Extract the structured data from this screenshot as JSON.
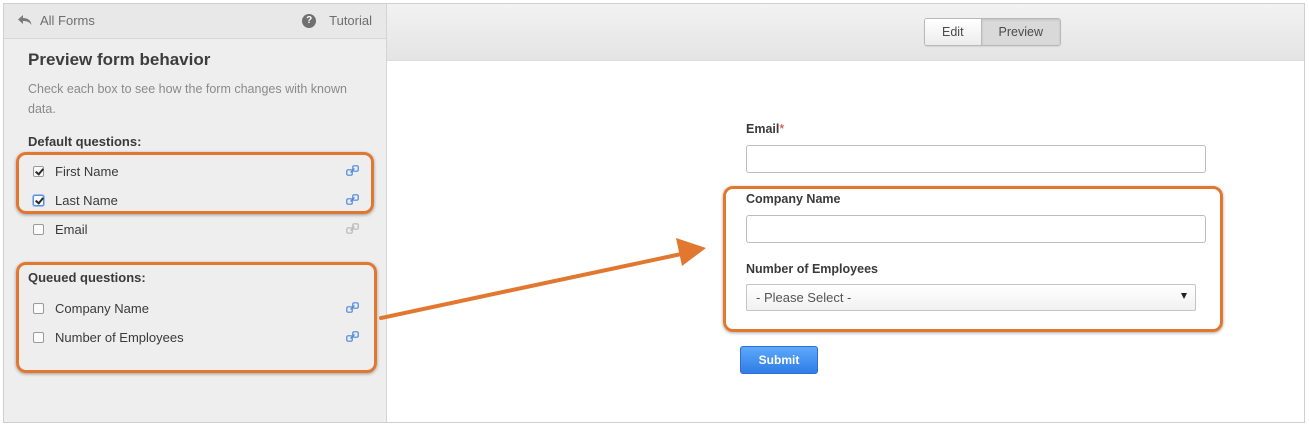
{
  "sidebar": {
    "back_label": "All Forms",
    "back_icon": "reply-arrow-icon",
    "tutorial_label": "Tutorial",
    "tutorial_icon": "help-circle-icon",
    "title": "Preview form behavior",
    "description": "Check each box to see how the form changes with known data.",
    "default_heading": "Default questions:",
    "default_questions": [
      {
        "label": "First Name",
        "checked": true
      },
      {
        "label": "Last Name",
        "checked": true
      },
      {
        "label": "Email",
        "checked": false
      }
    ],
    "queued_heading": "Queued questions:",
    "queued_questions": [
      {
        "label": "Company Name",
        "checked": false
      },
      {
        "label": "Number of Employees",
        "checked": false
      }
    ]
  },
  "toolbar": {
    "edit_label": "Edit",
    "preview_label": "Preview",
    "active_tab": "Preview"
  },
  "form": {
    "email_label": "Email",
    "email_required_mark": "*",
    "company_label": "Company Name",
    "employees_label": "Number of Employees",
    "employees_selected": "- Please Select -",
    "submit_label": "Submit"
  },
  "colors": {
    "highlight": "#e2772f",
    "link_icon": "#4a86d8",
    "submit": "#3b8ef0",
    "required": "#d0302c"
  }
}
